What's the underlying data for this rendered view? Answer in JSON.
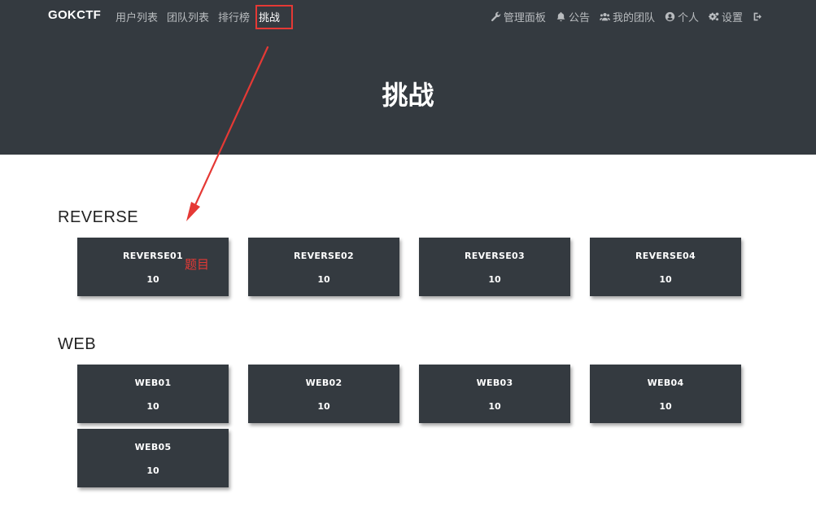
{
  "nav": {
    "brand": "GOKCTF",
    "left_links": [
      "用户列表",
      "团队列表",
      "排行榜",
      "挑战"
    ],
    "right_items": [
      {
        "label": "管理面板",
        "icon": "wrench-icon"
      },
      {
        "label": "公告",
        "icon": "bell-icon"
      },
      {
        "label": "我的团队",
        "icon": "users-icon"
      },
      {
        "label": "个人",
        "icon": "user-circle-icon"
      },
      {
        "label": "设置",
        "icon": "gears-icon"
      },
      {
        "label": "",
        "icon": "logout-icon"
      }
    ]
  },
  "page": {
    "title": "挑战"
  },
  "categories": [
    {
      "name": "REVERSE",
      "challenges": [
        {
          "name": "REVERSE01",
          "value": "10"
        },
        {
          "name": "REVERSE02",
          "value": "10"
        },
        {
          "name": "REVERSE03",
          "value": "10"
        },
        {
          "name": "REVERSE04",
          "value": "10"
        }
      ]
    },
    {
      "name": "WEB",
      "challenges": [
        {
          "name": "WEB01",
          "value": "10"
        },
        {
          "name": "WEB02",
          "value": "10"
        },
        {
          "name": "WEB03",
          "value": "10"
        },
        {
          "name": "WEB04",
          "value": "10"
        },
        {
          "name": "WEB05",
          "value": "10"
        }
      ]
    }
  ],
  "annotation": {
    "label": "题目",
    "color": "#e53935"
  },
  "colors": {
    "header_bg": "#343a40",
    "card_bg": "#343a40",
    "accent": "#e53935"
  }
}
